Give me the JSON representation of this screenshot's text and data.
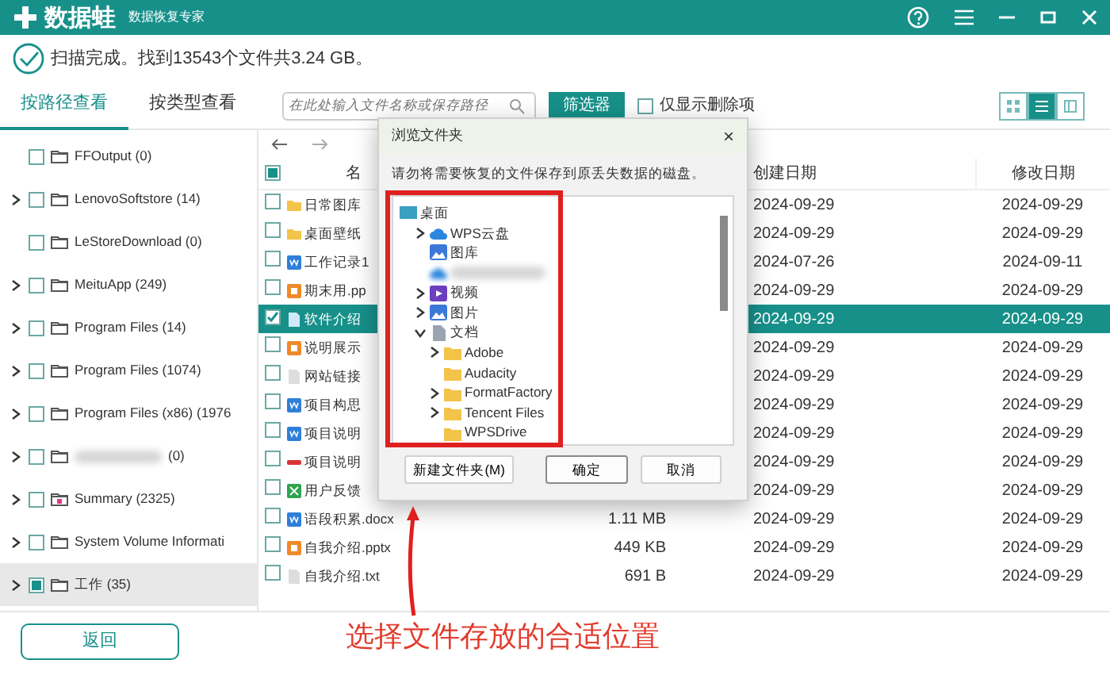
{
  "app": {
    "logo": "数据蛙",
    "subtitle": "数据恢复专家"
  },
  "status": "扫描完成。找到13543个文件共3.24 GB。",
  "view_tabs": [
    {
      "label": "按路径查看",
      "selected": true
    },
    {
      "label": "按类型查看",
      "selected": false
    }
  ],
  "search": {
    "placeholder": "在此处输入文件名称或保存路径"
  },
  "filter_button": "筛选器",
  "only_deleted": {
    "label": "仅显示删除项",
    "checked": false
  },
  "view_modes": [
    {
      "kind": "grid",
      "selected": false
    },
    {
      "kind": "list",
      "selected": true
    },
    {
      "kind": "preview",
      "selected": false
    }
  ],
  "tree": [
    {
      "label": "FFOutput (0)",
      "expandable": false,
      "checked": false,
      "indeterminate": false,
      "selected": false,
      "kind": "folder"
    },
    {
      "label": "LenovoSoftstore (14)",
      "expandable": true,
      "checked": false,
      "indeterminate": false,
      "selected": false,
      "kind": "folder"
    },
    {
      "label": "LeStoreDownload (0)",
      "expandable": false,
      "checked": false,
      "indeterminate": false,
      "selected": false,
      "kind": "folder"
    },
    {
      "label": "MeituApp (249)",
      "expandable": true,
      "checked": false,
      "indeterminate": false,
      "selected": false,
      "kind": "folder"
    },
    {
      "label": "Program Files (14)",
      "expandable": true,
      "checked": false,
      "indeterminate": false,
      "selected": false,
      "kind": "folder"
    },
    {
      "label": "Program Files (1074)",
      "expandable": true,
      "checked": false,
      "indeterminate": false,
      "selected": false,
      "kind": "folder"
    },
    {
      "label": "Program Files (x86) (1976",
      "expandable": true,
      "checked": false,
      "indeterminate": false,
      "selected": false,
      "kind": "folder"
    },
    {
      "label": "(0)",
      "redacted": true,
      "expandable": true,
      "checked": false,
      "indeterminate": false,
      "selected": false,
      "kind": "folder"
    },
    {
      "label": "Summary (2325)",
      "expandable": true,
      "checked": false,
      "indeterminate": false,
      "selected": false,
      "kind": "summary"
    },
    {
      "label": "System Volume Informati",
      "expandable": true,
      "checked": false,
      "indeterminate": false,
      "selected": false,
      "kind": "folder"
    },
    {
      "label": "工作 (35)",
      "expandable": true,
      "checked": false,
      "indeterminate": true,
      "selected": true,
      "kind": "folder"
    }
  ],
  "table": {
    "all_checked": false,
    "all_indeterminate": true,
    "columns": [
      "名",
      "创建日期",
      "修改日期"
    ],
    "rows": [
      {
        "kind": "folder",
        "name": "日常图库",
        "created": "2024-09-29",
        "modified": "2024-09-29",
        "checked": false,
        "selected": false
      },
      {
        "kind": "folder",
        "name": "桌面壁纸",
        "created": "2024-09-29",
        "modified": "2024-09-29",
        "checked": false,
        "selected": false
      },
      {
        "kind": "word",
        "name": "工作记录1",
        "created": "2024-07-26",
        "modified": "2024-09-11",
        "checked": false,
        "selected": false
      },
      {
        "kind": "ppt",
        "name": "期末用.pp",
        "created": "2024-09-29",
        "modified": "2024-09-29",
        "checked": false,
        "selected": false
      },
      {
        "kind": "txt",
        "name": "软件介绍",
        "created": "2024-09-29",
        "modified": "2024-09-29",
        "checked": true,
        "selected": true
      },
      {
        "kind": "ppt",
        "name": "说明展示",
        "created": "2024-09-29",
        "modified": "2024-09-29",
        "checked": false,
        "selected": false
      },
      {
        "kind": "txt",
        "name": "网站链接",
        "created": "2024-09-29",
        "modified": "2024-09-29",
        "checked": false,
        "selected": false
      },
      {
        "kind": "word",
        "name": "项目构思",
        "created": "2024-09-29",
        "modified": "2024-09-29",
        "checked": false,
        "selected": false
      },
      {
        "kind": "word",
        "name": "项目说明",
        "created": "2024-09-29",
        "modified": "2024-09-29",
        "checked": false,
        "selected": false
      },
      {
        "kind": "media",
        "name": "项目说明",
        "created": "2024-09-29",
        "modified": "2024-09-29",
        "checked": false,
        "selected": false
      },
      {
        "kind": "excel",
        "name": "用户反馈",
        "created": "2024-09-29",
        "modified": "2024-09-29",
        "checked": false,
        "selected": false
      },
      {
        "kind": "word",
        "name": "语段积累.docx",
        "size": "1.11 MB",
        "created": "2024-09-29",
        "modified": "2024-09-29",
        "checked": false,
        "selected": false
      },
      {
        "kind": "ppt",
        "name": "自我介绍.pptx",
        "size": "449 KB",
        "created": "2024-09-29",
        "modified": "2024-09-29",
        "checked": false,
        "selected": false
      },
      {
        "kind": "txt",
        "name": "自我介绍.txt",
        "size": "691 B",
        "created": "2024-09-29",
        "modified": "2024-09-29",
        "checked": false,
        "selected": false
      }
    ]
  },
  "back_button": "返回",
  "dialog": {
    "title": "浏览文件夹",
    "close": "×",
    "message": "请勿将需要恢复的文件保存到原丢失数据的磁盘。",
    "tree": [
      {
        "label": "桌面",
        "kind": "desktop",
        "expandable": false,
        "children": [
          {
            "label": "WPS云盘",
            "kind": "cloud",
            "expandable": true,
            "expanded": false
          },
          {
            "label": "图库",
            "kind": "gallery",
            "expandable": false
          },
          {
            "redacted": true,
            "kind": "cloud",
            "expandable": false
          },
          {
            "label": "视频",
            "kind": "video",
            "expandable": true,
            "expanded": false
          },
          {
            "label": "图片",
            "kind": "gallery",
            "expandable": true,
            "expanded": false
          },
          {
            "label": "文档",
            "kind": "docs",
            "expandable": true,
            "expanded": true,
            "children": [
              {
                "label": "Adobe",
                "kind": "folder",
                "expandable": true,
                "expanded": false
              },
              {
                "label": "Audacity",
                "kind": "folder",
                "expandable": false
              },
              {
                "label": "FormatFactory",
                "kind": "folder",
                "expandable": true,
                "expanded": false
              },
              {
                "label": "Tencent Files",
                "kind": "folder",
                "expandable": true,
                "expanded": false
              },
              {
                "label": "WPSDrive",
                "kind": "folder",
                "expandable": false
              }
            ]
          }
        ]
      }
    ],
    "buttons": [
      {
        "label": "新建文件夹(M)",
        "primary": false
      },
      {
        "label": "确定",
        "primary": true
      },
      {
        "label": "取消",
        "primary": false
      }
    ]
  },
  "annotation": "选择文件存放的合适位置"
}
